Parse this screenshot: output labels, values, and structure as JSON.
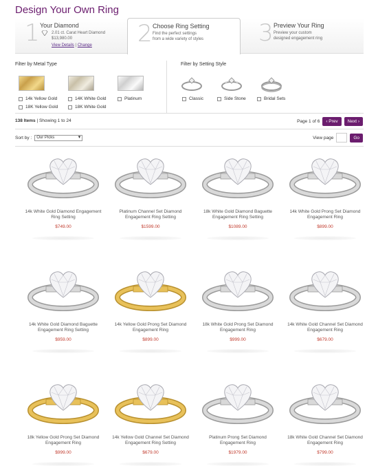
{
  "page": {
    "title": "Design Your Own Ring"
  },
  "steps": [
    {
      "num": "1",
      "title": "Your Diamond",
      "line1": "2.01 ct. Carat Heart Diamond",
      "line2": "$13,980.00",
      "view_details": "View Details",
      "separator": "|",
      "change": "Change"
    },
    {
      "num": "2",
      "title": "Choose Ring Setting",
      "line1": "Find the perfect settings",
      "line2": "from a wide variety of styles"
    },
    {
      "num": "3",
      "title": "Preview Your Ring",
      "line1": "Preview your custom",
      "line2": "designed engagement ring"
    }
  ],
  "filters": {
    "metal_heading": "Filter by Metal Type",
    "metal_options": [
      "14k Yellow Gold",
      "14K White Gold",
      "Platinum",
      "18K Yellow Gold",
      "18K White Gold"
    ],
    "style_heading": "Filter by Setting Style",
    "style_options": [
      "Classic",
      "Side Stone",
      "Bridal Sets"
    ]
  },
  "results": {
    "count": "138 Items",
    "showing": "| Showing 1 to 24",
    "page_of": "Page 1 of 6",
    "prev": "‹ Prev",
    "next": "Next ›",
    "sort_label": "Sort by :",
    "sort_value": "Our Picks",
    "view_page": "View page",
    "go": "Go"
  },
  "products": [
    {
      "name": "14k White Gold Diamond Engagement Ring Setting",
      "price": "$749.00",
      "metal": "white"
    },
    {
      "name": "Platinum Channel Set Diamond Engagement Ring Setting",
      "price": "$1599.00",
      "metal": "white"
    },
    {
      "name": "18k White Gold Diamond Baguette Engagement Ring Setting",
      "price": "$1089.00",
      "metal": "white"
    },
    {
      "name": "14k White Gold Prong Set Diamond Engagement Ring",
      "price": "$899.00",
      "metal": "white"
    },
    {
      "name": "14k White Gold Diamond Baguette Engagement Ring Setting",
      "price": "$959.00",
      "metal": "white"
    },
    {
      "name": "14k Yellow Gold Prong Set Diamond Engagement Ring",
      "price": "$899.00",
      "metal": "yellow"
    },
    {
      "name": "18k White Gold Prong Set Diamond Engagement Ring",
      "price": "$999.00",
      "metal": "white"
    },
    {
      "name": "14k White Gold Channel Set Diamond Engagement Ring",
      "price": "$679.00",
      "metal": "white"
    },
    {
      "name": "18k Yellow Gold Prong Set Diamond Engagement Ring",
      "price": "$999.00",
      "metal": "yellow"
    },
    {
      "name": "14k Yellow Gold Channel Set Diamond Engagement Ring Setting",
      "price": "$679.00",
      "metal": "yellow"
    },
    {
      "name": "Platinum Prong Set Diamond Engagement Ring",
      "price": "$1979.00",
      "metal": "white"
    },
    {
      "name": "18k White Gold Channel Set Diamond Engagement Ring",
      "price": "$799.00",
      "metal": "white"
    }
  ],
  "colors": {
    "brand": "#6b1d6e",
    "price": "#c0392b",
    "white_metal": "#d9d9d9",
    "yellow_metal": "#e8c15a"
  }
}
